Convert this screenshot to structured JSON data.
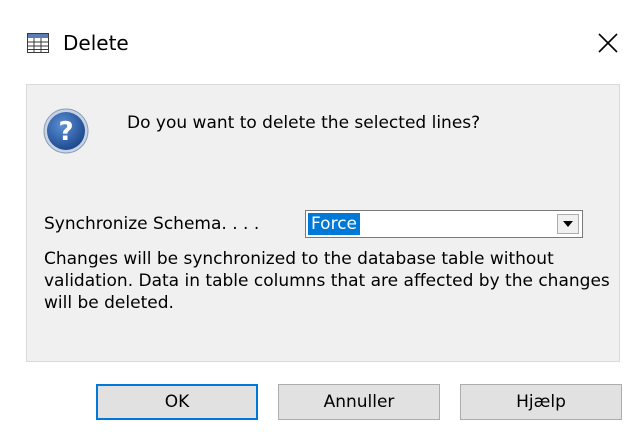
{
  "window": {
    "title": "Delete",
    "close_glyph": "✕",
    "icon": "table-window-icon"
  },
  "message": {
    "icon": "question-icon",
    "text": "Do you want to delete the selected lines?"
  },
  "sync": {
    "label": "Synchronize Schema. . . .",
    "selected": "Force",
    "arrow_glyph": "▼"
  },
  "description": "Changes will be synchronized to the database table without validation. Data in table columns that are affected by the changes will be deleted.",
  "buttons": {
    "ok": "OK",
    "cancel": "Annuller",
    "help": "Hjælp"
  },
  "colors": {
    "accent": "#0078d7",
    "question_icon": "#2b579a"
  }
}
